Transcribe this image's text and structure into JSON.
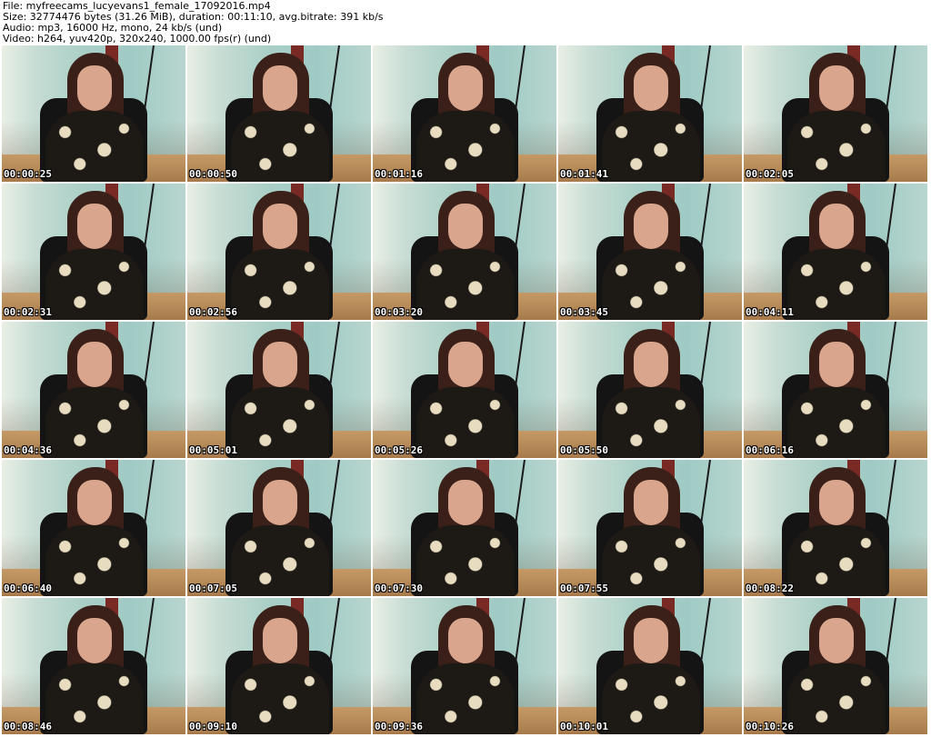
{
  "header": {
    "file_line": "File: myfreecams_lucyevans1_female_17092016.mp4",
    "size_line": "Size: 32774476 bytes (31.26 MiB), duration: 00:11:10, avg.bitrate: 391 kb/s",
    "audio_line": "Audio: mp3, 16000 Hz, mono, 24 kb/s (und)",
    "video_line": "Video: h264, yuv420p, 320x240, 1000.00 fps(r) (und)"
  },
  "thumbnails": [
    {
      "timestamp": "00:00:25"
    },
    {
      "timestamp": "00:00:50"
    },
    {
      "timestamp": "00:01:16"
    },
    {
      "timestamp": "00:01:41"
    },
    {
      "timestamp": "00:02:05"
    },
    {
      "timestamp": "00:02:31"
    },
    {
      "timestamp": "00:02:56"
    },
    {
      "timestamp": "00:03:20"
    },
    {
      "timestamp": "00:03:45"
    },
    {
      "timestamp": "00:04:11"
    },
    {
      "timestamp": "00:04:36"
    },
    {
      "timestamp": "00:05:01"
    },
    {
      "timestamp": "00:05:26"
    },
    {
      "timestamp": "00:05:50"
    },
    {
      "timestamp": "00:06:16"
    },
    {
      "timestamp": "00:06:40"
    },
    {
      "timestamp": "00:07:05"
    },
    {
      "timestamp": "00:07:30"
    },
    {
      "timestamp": "00:07:55"
    },
    {
      "timestamp": "00:08:22"
    },
    {
      "timestamp": "00:08:46"
    },
    {
      "timestamp": "00:09:10"
    },
    {
      "timestamp": "00:09:36"
    },
    {
      "timestamp": "00:10:01"
    },
    {
      "timestamp": "00:10:26"
    }
  ]
}
